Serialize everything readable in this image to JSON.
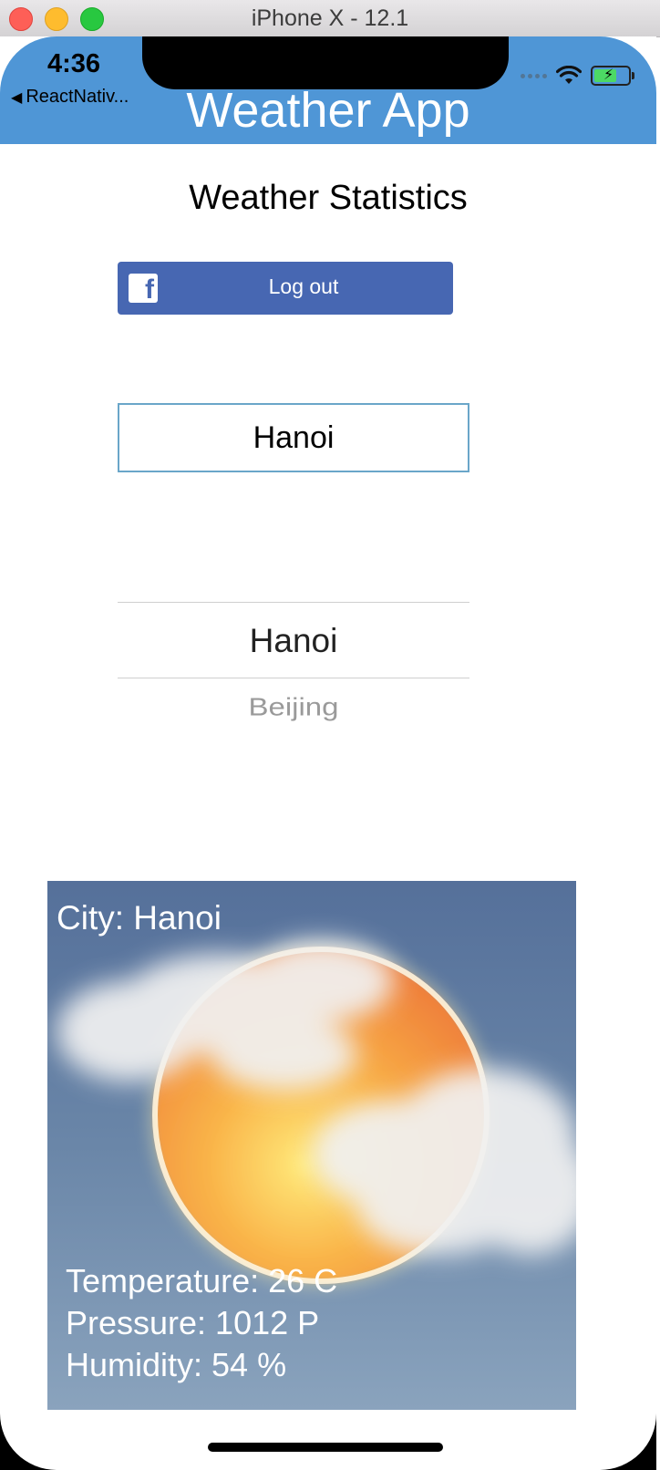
{
  "window": {
    "title": "iPhone X - 12.1"
  },
  "status_bar": {
    "time": "4:36",
    "back_label": "ReactNativ..."
  },
  "nav": {
    "title": "Weather App"
  },
  "main": {
    "subtitle": "Weather Statistics",
    "logout_label": "Log out",
    "city_input_value": "Hanoi",
    "picker": {
      "selected": "Hanoi",
      "next": "Beijing"
    }
  },
  "weather_card": {
    "city": "City: Hanoi",
    "temperature": "Temperature: 26 C",
    "pressure": "Pressure: 1012 P",
    "humidity": "Humidity: 54 %"
  },
  "colors": {
    "nav_bar": "#4f96d6",
    "facebook_button": "#4767b2",
    "input_border": "#6aa6c9",
    "card_background": "#6a86a8"
  }
}
